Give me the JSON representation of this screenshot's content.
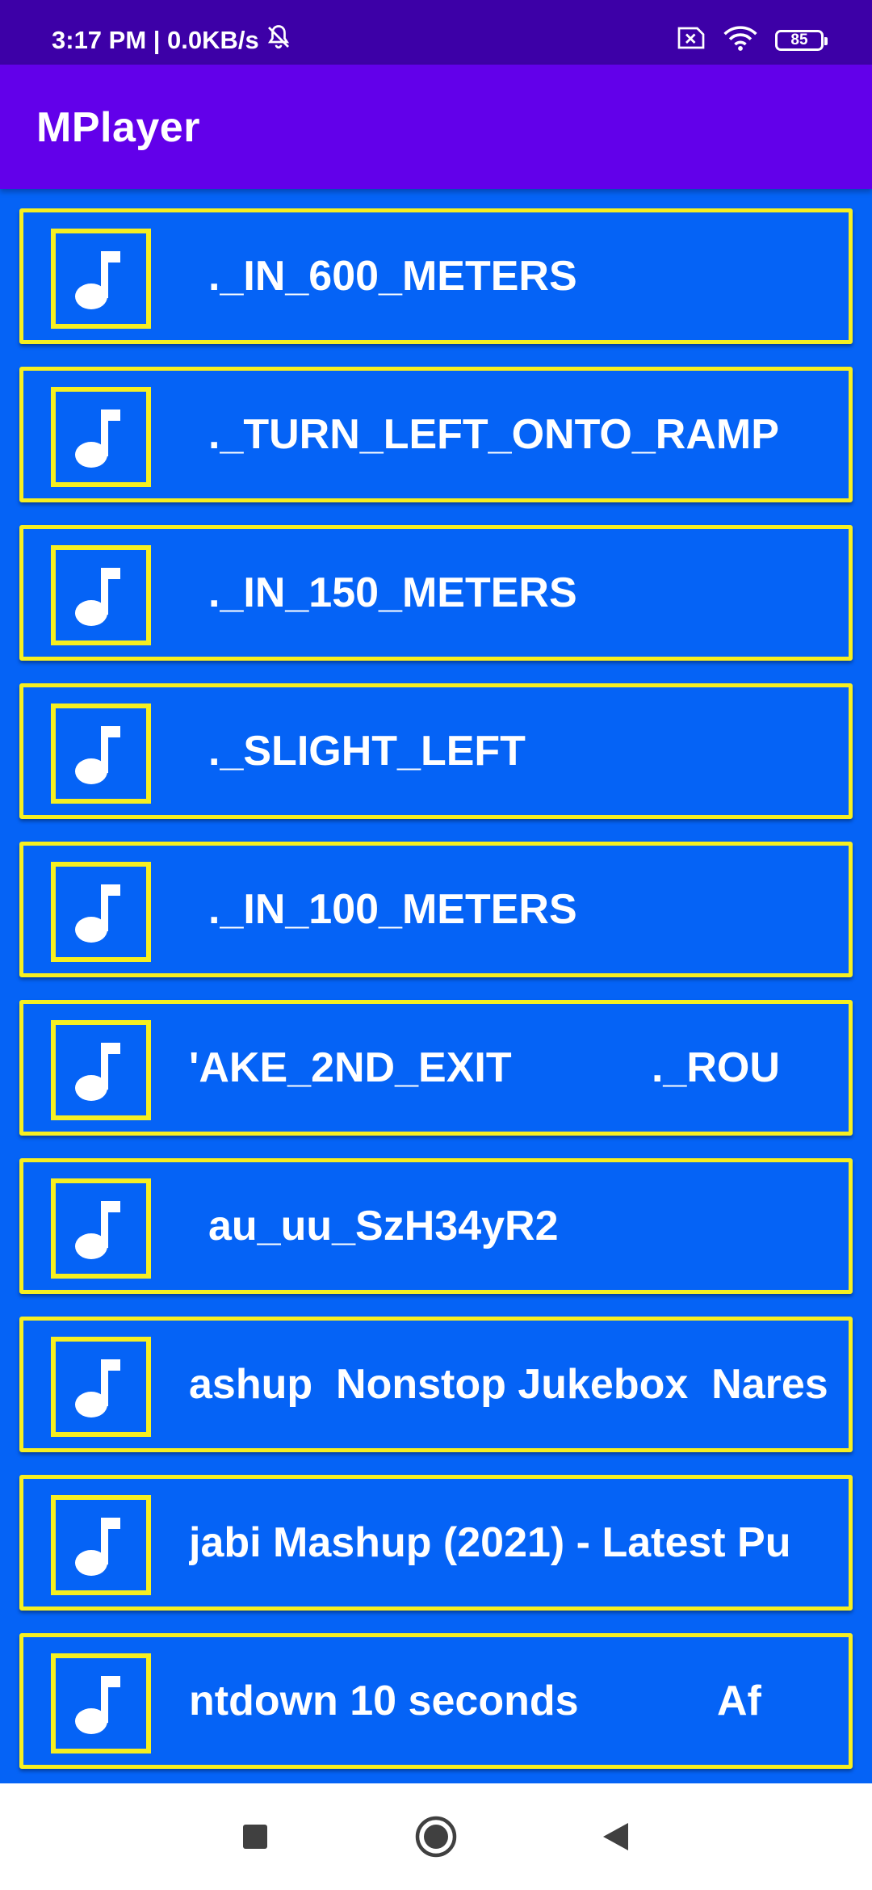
{
  "status_bar": {
    "time": "3:17 PM | 0.0KB/s",
    "battery": "85",
    "icons": [
      "muted-bell-icon",
      "sim-x-icon",
      "wifi-icon",
      "battery-icon"
    ]
  },
  "app_bar": {
    "title": "MPlayer"
  },
  "songs": [
    {
      "title": "._IN_600_METERS"
    },
    {
      "title": "._TURN_LEFT_ONTO_RAMP"
    },
    {
      "title": "._IN_150_METERS"
    },
    {
      "title": "._SLIGHT_LEFT"
    },
    {
      "title": "._IN_100_METERS"
    },
    {
      "title": "'AKE_2ND_EXIT            ._ROU"
    },
    {
      "title": "au_uu_SzH34yR2"
    },
    {
      "title": "ashup  Nonstop Jukebox  Nares"
    },
    {
      "title": "jabi Mashup (2021) - Latest Pu"
    },
    {
      "title": "ntdown 10 seconds            Af"
    }
  ],
  "colors": {
    "status_bar": "#3D00A7",
    "app_bar": "#6200EA",
    "background": "#0563F6",
    "border": "#F6EF21",
    "text": "#FFFFFF"
  },
  "nav": {
    "buttons": [
      "recents-square-icon",
      "home-circle-icon",
      "back-triangle-icon"
    ]
  }
}
